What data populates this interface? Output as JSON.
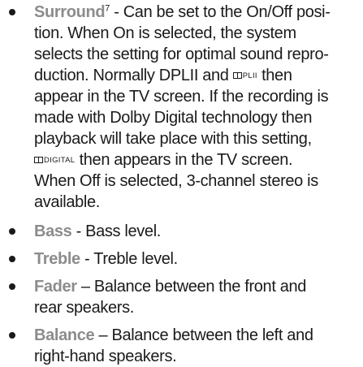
{
  "items": [
    {
      "term": "Surround",
      "sup": "7",
      "line1": " - Can be set to the On/Off posi-",
      "line2": "tion. When On is selected, the system",
      "line3": "selects the setting for optimal sound repro-",
      "line4a": "duction. Normally DPLII and ",
      "logo_pl2": "PLII",
      "line4b": " then",
      "line5": "appear in the TV screen. If the recording is",
      "line6": "made with Dolby Digital technology then",
      "line7": "playback will take place with this setting,",
      "logo_digital": "DIGITAL",
      "line8b": " then appears in the TV screen.",
      "line9": "When Off is selected, 3-channel stereo is",
      "line10": "available."
    },
    {
      "term": "Bass",
      "desc": " - Bass level."
    },
    {
      "term": "Treble",
      "desc": " - Treble level."
    },
    {
      "term": "Fader",
      "line1": " – Balance between the front and",
      "line2": "rear speakers."
    },
    {
      "term": "Balance",
      "line1": " – Balance between the left and",
      "line2": "right-hand speakers."
    }
  ]
}
